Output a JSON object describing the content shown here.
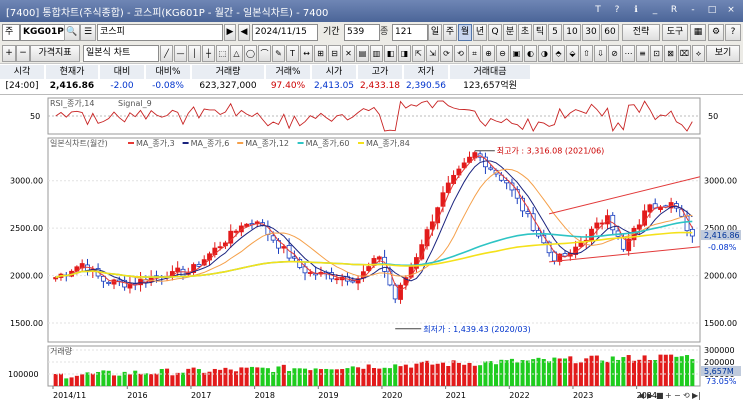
{
  "window": {
    "title": "[7400] 통합차트(주식종합) - 코스피(KG601P - 월간 - 일본식차트) - 7400",
    "title_buttons": [
      "T",
      "?",
      "ℹ",
      "_",
      "R",
      "-",
      "□",
      "×"
    ]
  },
  "toolbar": {
    "market": "주",
    "code": "KGG01P",
    "name": "코스피",
    "date": "2024/11/15",
    "period_label": "기간",
    "period_value": "539",
    "count_label": "종",
    "count_value": "121",
    "periods": [
      "일",
      "주",
      "월",
      "년",
      "Q",
      "분",
      "초",
      "틱",
      "5",
      "10",
      "30",
      "60"
    ],
    "active_period": "월",
    "trade_label": "전략",
    "tools_label": "도구",
    "view_label": "보기"
  },
  "toolbar2": {
    "price_index_label": "가격지표",
    "chart_type": "일본식 차트"
  },
  "quote": {
    "headers": [
      "시각",
      "현재가",
      "대비",
      "대비%",
      "거래량",
      "거래%",
      "시가",
      "고가",
      "저가",
      "거래대금"
    ],
    "values": [
      "[24:00]",
      "2,416.86",
      "-2.00",
      "-0.08%",
      "623,327,000",
      "97.40%",
      "2,413.05",
      "2,433.18",
      "2,390.56",
      "123,657억원"
    ],
    "colors": [
      "#000000",
      "#000000",
      "#0033cc",
      "#0033cc",
      "#000000",
      "#cc0000",
      "#0033cc",
      "#cc0000",
      "#0033cc",
      "#000000"
    ]
  },
  "rsi_panel": {
    "legend": "RSI_종가,14",
    "signal": "Signal_9",
    "axis_label": "50"
  },
  "price_panel": {
    "legend_title": "일본식차트(월간)",
    "ma_legends": [
      {
        "label": "MA_종가,3",
        "color": "#e53935"
      },
      {
        "label": "MA_종가,6",
        "color": "#1a237e"
      },
      {
        "label": "MA_종가,12",
        "color": "#f5a04a"
      },
      {
        "label": "MA_종가,60",
        "color": "#2ec4c4"
      },
      {
        "label": "MA_종가,84",
        "color": "#f4e11a"
      }
    ],
    "high_label": "최고가 : 3,316.08 (2021/06)",
    "low_label": "최저가 : 1,439.43 (2020/03)",
    "last_price": "2,416.86",
    "last_change": "-0.08%",
    "y_ticks": [
      "3000.00",
      "2500.00",
      "2000.00",
      "1500.00"
    ]
  },
  "volume_panel": {
    "legend": "거래량",
    "y_ticks": [
      "300000",
      "200000",
      "100000"
    ],
    "left_tick": "100000",
    "last_volume": "5,657M",
    "last_ratio": "73.05%"
  },
  "x_axis": [
    "2014/11",
    "2016",
    "2017",
    "2018",
    "2019",
    "2020",
    "2021",
    "2022",
    "2023",
    "2024"
  ],
  "colors": {
    "up": "#e21b1b",
    "down": "#1a3fbf",
    "vol_up": "#e21b1b",
    "vol_down": "#1fcc1f",
    "channel": "#e23a3a",
    "rsi": "#c82323"
  },
  "chart_data": {
    "type": "candlestick",
    "frequency": "monthly",
    "x_labels": [
      "2014/11",
      "2016",
      "2017",
      "2018",
      "2019",
      "2020",
      "2021",
      "2022",
      "2023",
      "2024"
    ],
    "y_axis": {
      "ticks": [
        3000,
        2500,
        2000,
        1500
      ],
      "range": [
        1300,
        3450
      ]
    },
    "anchors": [
      {
        "date": "2014/11",
        "close": 1980
      },
      {
        "date": "2015/04",
        "close": 2127
      },
      {
        "date": "2015/08",
        "close": 1941
      },
      {
        "date": "2016/01",
        "close": 1912
      },
      {
        "date": "2016/09",
        "close": 2043
      },
      {
        "date": "2016/12",
        "close": 2026
      },
      {
        "date": "2017/10",
        "close": 2523
      },
      {
        "date": "2018/01",
        "close": 2566
      },
      {
        "date": "2018/10",
        "close": 2029
      },
      {
        "date": "2019/08",
        "close": 1967
      },
      {
        "date": "2019/12",
        "close": 2197
      },
      {
        "date": "2020/03",
        "close": 1754
      },
      {
        "date": "2020/08",
        "close": 2326
      },
      {
        "date": "2020/12",
        "close": 2873
      },
      {
        "date": "2021/06",
        "close": 3296
      },
      {
        "date": "2021/12",
        "close": 2977
      },
      {
        "date": "2022/09",
        "close": 2155
      },
      {
        "date": "2022/12",
        "close": 2236
      },
      {
        "date": "2023/07",
        "close": 2632
      },
      {
        "date": "2023/10",
        "close": 2277
      },
      {
        "date": "2024/03",
        "close": 2746
      },
      {
        "date": "2024/07",
        "close": 2770
      },
      {
        "date": "2024/11",
        "close": 2417
      }
    ],
    "highest": {
      "value": 3316.08,
      "date": "2021/06"
    },
    "lowest": {
      "value": 1439.43,
      "date": "2020/03"
    },
    "last": {
      "close": 2416.86,
      "change_pct": -0.08
    }
  }
}
